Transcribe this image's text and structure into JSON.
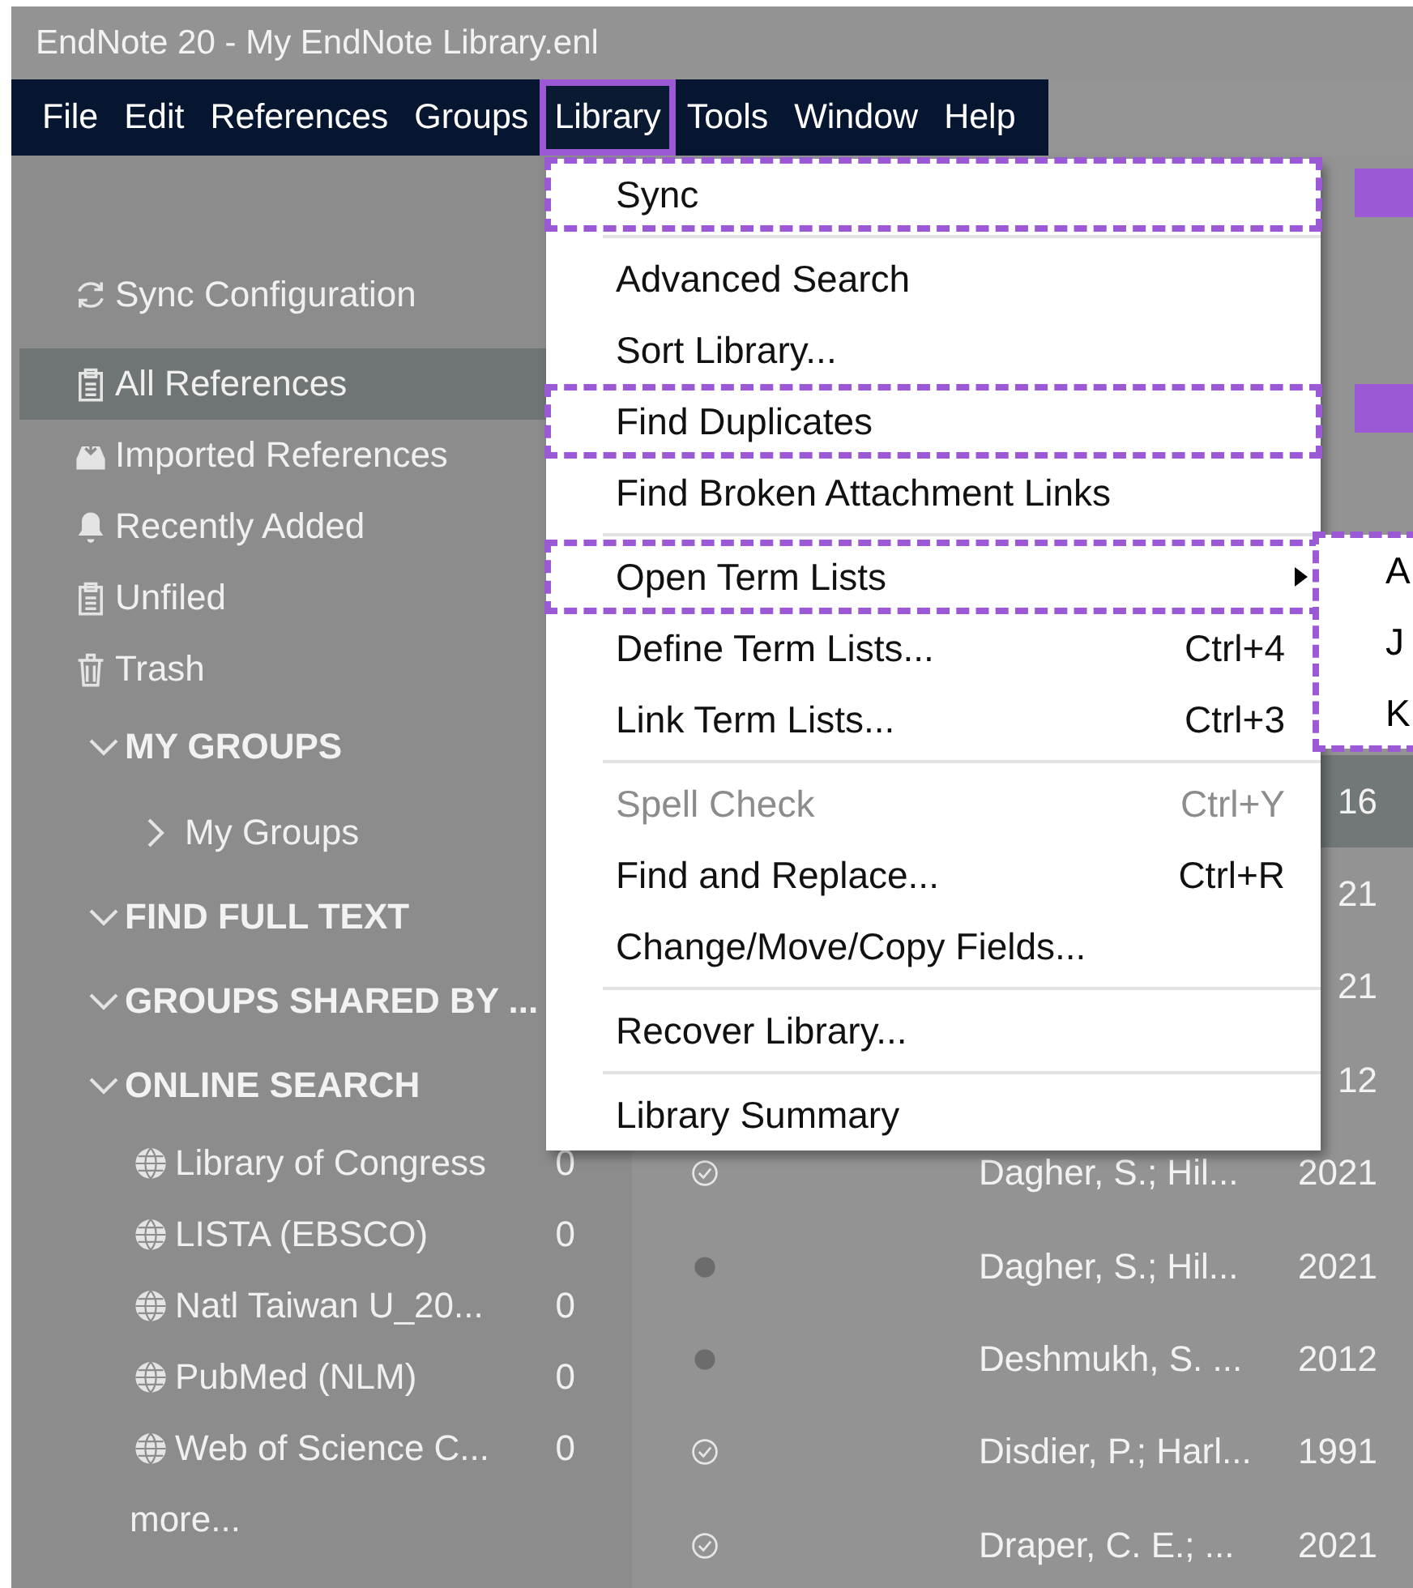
{
  "window": {
    "title": "EndNote 20 - My EndNote Library.enl"
  },
  "menubar": [
    {
      "label": "File",
      "selected": false
    },
    {
      "label": "Edit",
      "selected": false
    },
    {
      "label": "References",
      "selected": false
    },
    {
      "label": "Groups",
      "selected": false
    },
    {
      "label": "Library",
      "selected": true
    },
    {
      "label": "Tools",
      "selected": false
    },
    {
      "label": "Window",
      "selected": false
    },
    {
      "label": "Help",
      "selected": false
    }
  ],
  "sidebar": {
    "items": [
      {
        "kind": "sync",
        "label": "Sync Configuration",
        "selected": false
      },
      {
        "kind": "all",
        "label": "All References",
        "selected": true
      },
      {
        "kind": "imported",
        "label": "Imported References",
        "selected": false
      },
      {
        "kind": "recent",
        "label": "Recently Added",
        "selected": false
      },
      {
        "kind": "unfiled",
        "label": "Unfiled",
        "selected": false
      },
      {
        "kind": "trash",
        "label": "Trash",
        "selected": false
      },
      {
        "kind": "heading",
        "label": "MY GROUPS",
        "expanded": true,
        "children": [
          {
            "kind": "group-set",
            "label": "My Groups",
            "expanded": false,
            "selected": false
          }
        ]
      },
      {
        "kind": "heading",
        "label": "FIND FULL TEXT",
        "expanded": true
      },
      {
        "kind": "heading",
        "label": "GROUPS SHARED BY ...",
        "expanded": true
      },
      {
        "kind": "heading",
        "label": "ONLINE SEARCH",
        "expanded": true,
        "children": [
          {
            "kind": "online",
            "label": "Library of Congress",
            "count": "0",
            "selected": false
          },
          {
            "kind": "online",
            "label": "LISTA (EBSCO)",
            "count": "0",
            "selected": false
          },
          {
            "kind": "online",
            "label": "Natl Taiwan U_20...",
            "count": "0",
            "selected": false
          },
          {
            "kind": "online",
            "label": "PubMed (NLM)",
            "count": "0",
            "selected": false
          },
          {
            "kind": "online",
            "label": "Web of Science C...",
            "count": "0",
            "selected": false
          },
          {
            "kind": "link",
            "label": "more...",
            "selected": false
          }
        ]
      }
    ]
  },
  "references": [
    {
      "year": "16",
      "selected": true
    },
    {
      "year": "21",
      "selected": false
    },
    {
      "year": "21",
      "selected": false
    },
    {
      "year": "12",
      "selected": false
    },
    {
      "kind": "read",
      "author": "Dagher, S.; Hil...",
      "year": "2021",
      "selected": false
    },
    {
      "kind": "unread",
      "author": "Dagher, S.; Hil...",
      "year": "2021",
      "selected": false
    },
    {
      "kind": "unread",
      "author": "Deshmukh, S. ...",
      "year": "2012",
      "selected": false
    },
    {
      "kind": "read",
      "author": "Disdier, P.; Harl...",
      "year": "1991",
      "selected": false
    },
    {
      "kind": "read",
      "author": "Draper, C. E.; ...",
      "year": "2021",
      "selected": false
    }
  ],
  "library_menu": {
    "items": [
      {
        "kind": "item",
        "label": "Sync",
        "disabled": false,
        "submenu": false,
        "annotated": true
      },
      {
        "kind": "separator"
      },
      {
        "kind": "item",
        "label": "Advanced Search",
        "disabled": false,
        "submenu": false,
        "annotated": false
      },
      {
        "kind": "item",
        "label": "Sort Library...",
        "disabled": false,
        "submenu": false,
        "annotated": false
      },
      {
        "kind": "item",
        "label": "Find Duplicates",
        "disabled": false,
        "submenu": false,
        "annotated": true
      },
      {
        "kind": "item",
        "label": "Find Broken Attachment Links",
        "disabled": false,
        "submenu": false,
        "annotated": false
      },
      {
        "kind": "separator"
      },
      {
        "kind": "item",
        "label": "Open Term Lists",
        "disabled": false,
        "submenu": true,
        "annotated": true
      },
      {
        "kind": "item",
        "label": "Define Term Lists...",
        "shortcut": "Ctrl+4",
        "disabled": false,
        "submenu": false,
        "annotated": false
      },
      {
        "kind": "item",
        "label": "Link Term Lists...",
        "shortcut": "Ctrl+3",
        "disabled": false,
        "submenu": false,
        "annotated": false
      },
      {
        "kind": "separator"
      },
      {
        "kind": "item",
        "label": "Spell Check",
        "shortcut": "Ctrl+Y",
        "disabled": true,
        "submenu": false,
        "annotated": false
      },
      {
        "kind": "item",
        "label": "Find and Replace...",
        "shortcut": "Ctrl+R",
        "disabled": false,
        "submenu": false,
        "annotated": false
      },
      {
        "kind": "item",
        "label": "Change/Move/Copy Fields...",
        "disabled": false,
        "submenu": false,
        "annotated": false
      },
      {
        "kind": "separator"
      },
      {
        "kind": "item",
        "label": "Recover Library...",
        "disabled": false,
        "submenu": false,
        "annotated": false
      },
      {
        "kind": "separator"
      },
      {
        "kind": "item",
        "label": "Library Summary",
        "disabled": false,
        "submenu": false,
        "annotated": false
      }
    ]
  },
  "callouts": [
    {
      "kind": "marker"
    },
    {
      "kind": "marker"
    }
  ],
  "term_lists_submenu": {
    "annotated": true,
    "items": [
      "A",
      "J",
      "K"
    ]
  }
}
